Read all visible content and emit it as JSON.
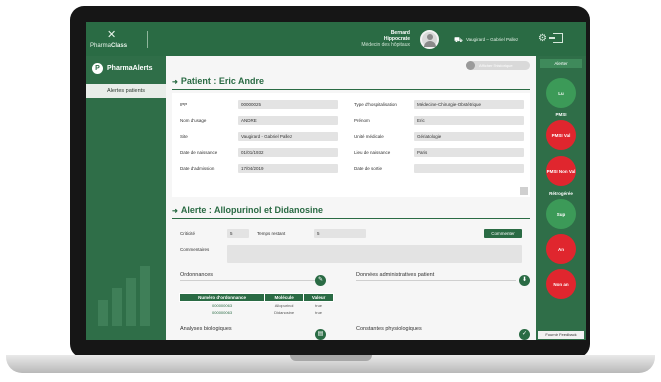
{
  "topbar": {
    "logo_text_a": "Pharma",
    "logo_text_b": "Class",
    "user_name_1": "Bernard",
    "user_name_2": "Hippocrate",
    "user_role": "Médecin des hôpitaux",
    "service": "Vaugirard – Gabriel Pallez"
  },
  "sidebar": {
    "brand": "PharmaAlerts",
    "nav_item": "Alertes patients"
  },
  "main": {
    "toggle_label": "Afficher l'historique",
    "patient_title": "Patient : Eric Andre",
    "patient_fields": {
      "ipp_label": "IPP",
      "ipp": "00000025",
      "nom_label": "Nom d'usage",
      "nom": "ANDRE",
      "site_label": "Site",
      "site": "Vaugirard - Gabriel Pallez",
      "naissance_label": "Date de naissance",
      "naissance": "01/01/1932",
      "admission_label": "Date d'admission",
      "admission": "17/04/2019",
      "type_label": "Type d'hospitalisation",
      "type": "Médecine-Chirurgie-Obstétrique",
      "prenom_label": "Prénom",
      "prenom": "Eric",
      "unite_label": "Unité médicale",
      "unite": "Gériatologie",
      "lieu_label": "Lieu de naissance",
      "lieu": "Paris",
      "sortie_label": "Date de sortie",
      "sortie": ""
    },
    "alert_title": "Alerte : Allopurinol et Didanosine",
    "alert_fields": {
      "criticite_label": "Criticité",
      "criticite": "5",
      "temps_label": "Temps restant",
      "temps": "5",
      "commentaires_label": "Commentaires",
      "comment_button": "Commenter"
    },
    "ordonnances": {
      "title": "Ordonnances",
      "headers": [
        "Numéro d'ordonnance",
        "Molécule",
        "Valeur"
      ],
      "rows": [
        [
          "000000063",
          "Allopurinol",
          "true"
        ],
        [
          "000000063",
          "Didanosine",
          "true"
        ]
      ]
    },
    "donnees_title": "Données administratives patient",
    "analyses_title": "Analyses biologiques",
    "constantes_title": "Constantes physiologiques"
  },
  "rail": {
    "tab": "Alerter",
    "c1": "Lu",
    "label_pmsi": "PMSI",
    "c2": "PMSI Val",
    "c3": "PMSI Non Val",
    "label_retro": "Rétrogérée",
    "c4": "Sup",
    "c5": "An",
    "c6": "Non an",
    "feedback": "Fournir Feedback"
  },
  "colors": {
    "primary_green": "#2a6b44",
    "rail_green_button": "#3c9a58",
    "rail_red_button": "#e0262e"
  }
}
